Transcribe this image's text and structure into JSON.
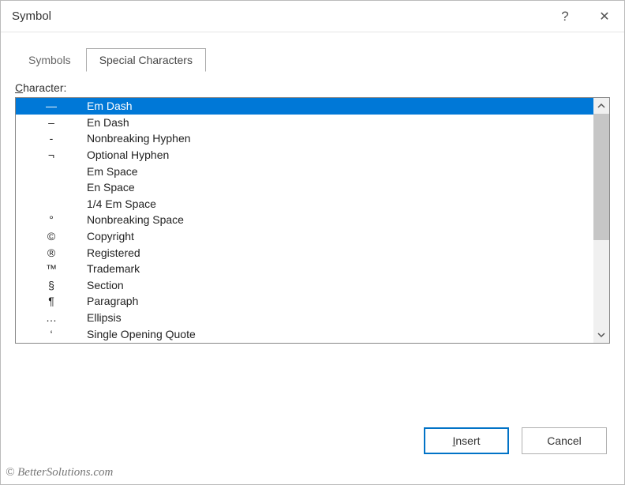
{
  "titlebar": {
    "title": "Symbol",
    "help": "?",
    "close": "✕"
  },
  "tabs": {
    "symbols": "Symbols",
    "special": "Special Characters"
  },
  "label_char_prefix": "C",
  "label_char_rest": "haracter:",
  "items": [
    {
      "sym": "—",
      "name": "Em Dash",
      "selected": true
    },
    {
      "sym": "–",
      "name": "En Dash"
    },
    {
      "sym": "-",
      "name": "Nonbreaking Hyphen"
    },
    {
      "sym": "¬",
      "name": "Optional Hyphen"
    },
    {
      "sym": "",
      "name": "Em Space"
    },
    {
      "sym": "",
      "name": "En Space"
    },
    {
      "sym": "",
      "name": "1/4 Em Space"
    },
    {
      "sym": "°",
      "name": "Nonbreaking Space"
    },
    {
      "sym": "©",
      "name": "Copyright"
    },
    {
      "sym": "®",
      "name": "Registered"
    },
    {
      "sym": "™",
      "name": "Trademark"
    },
    {
      "sym": "§",
      "name": "Section"
    },
    {
      "sym": "¶",
      "name": "Paragraph"
    },
    {
      "sym": "…",
      "name": "Ellipsis"
    },
    {
      "sym": "‘",
      "name": "Single Opening Quote"
    }
  ],
  "buttons": {
    "insert_u": "I",
    "insert_rest": "nsert",
    "cancel": "Cancel"
  },
  "watermark": "© BetterSolutions.com"
}
